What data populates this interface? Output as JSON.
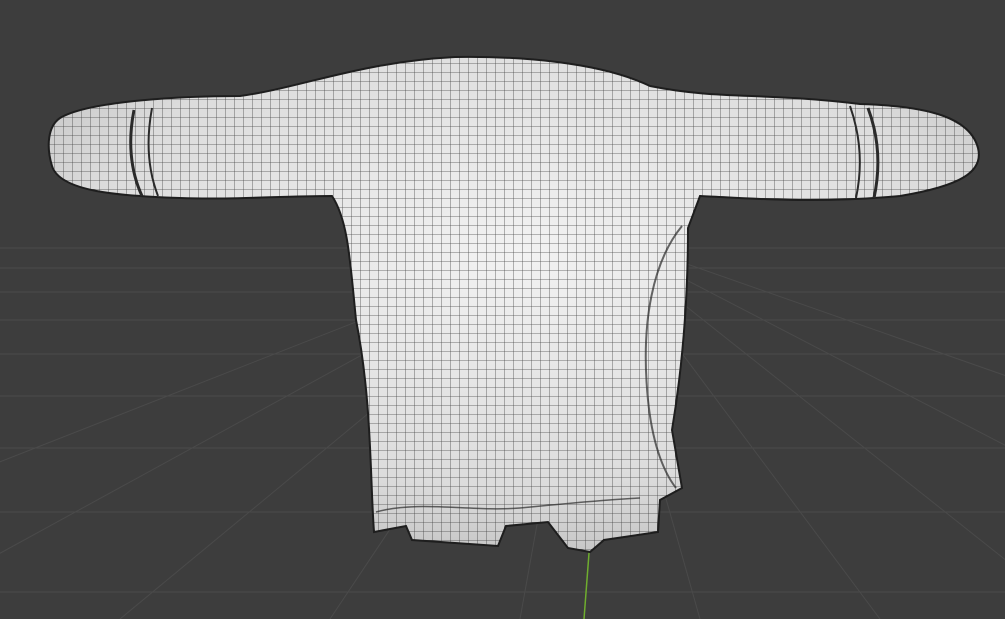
{
  "viewport": {
    "background_color": "#3d3d3d",
    "grid_line_color": "#4a4a4a",
    "y_axis_color": "#6fae2e",
    "mesh_fill_color": "#e6e6e6",
    "mesh_wire_color": "#2b2b2b",
    "display_mode": "wireframe-overlay",
    "object": {
      "kind": "sweater",
      "icon": "mesh-icon",
      "selected": false
    }
  }
}
